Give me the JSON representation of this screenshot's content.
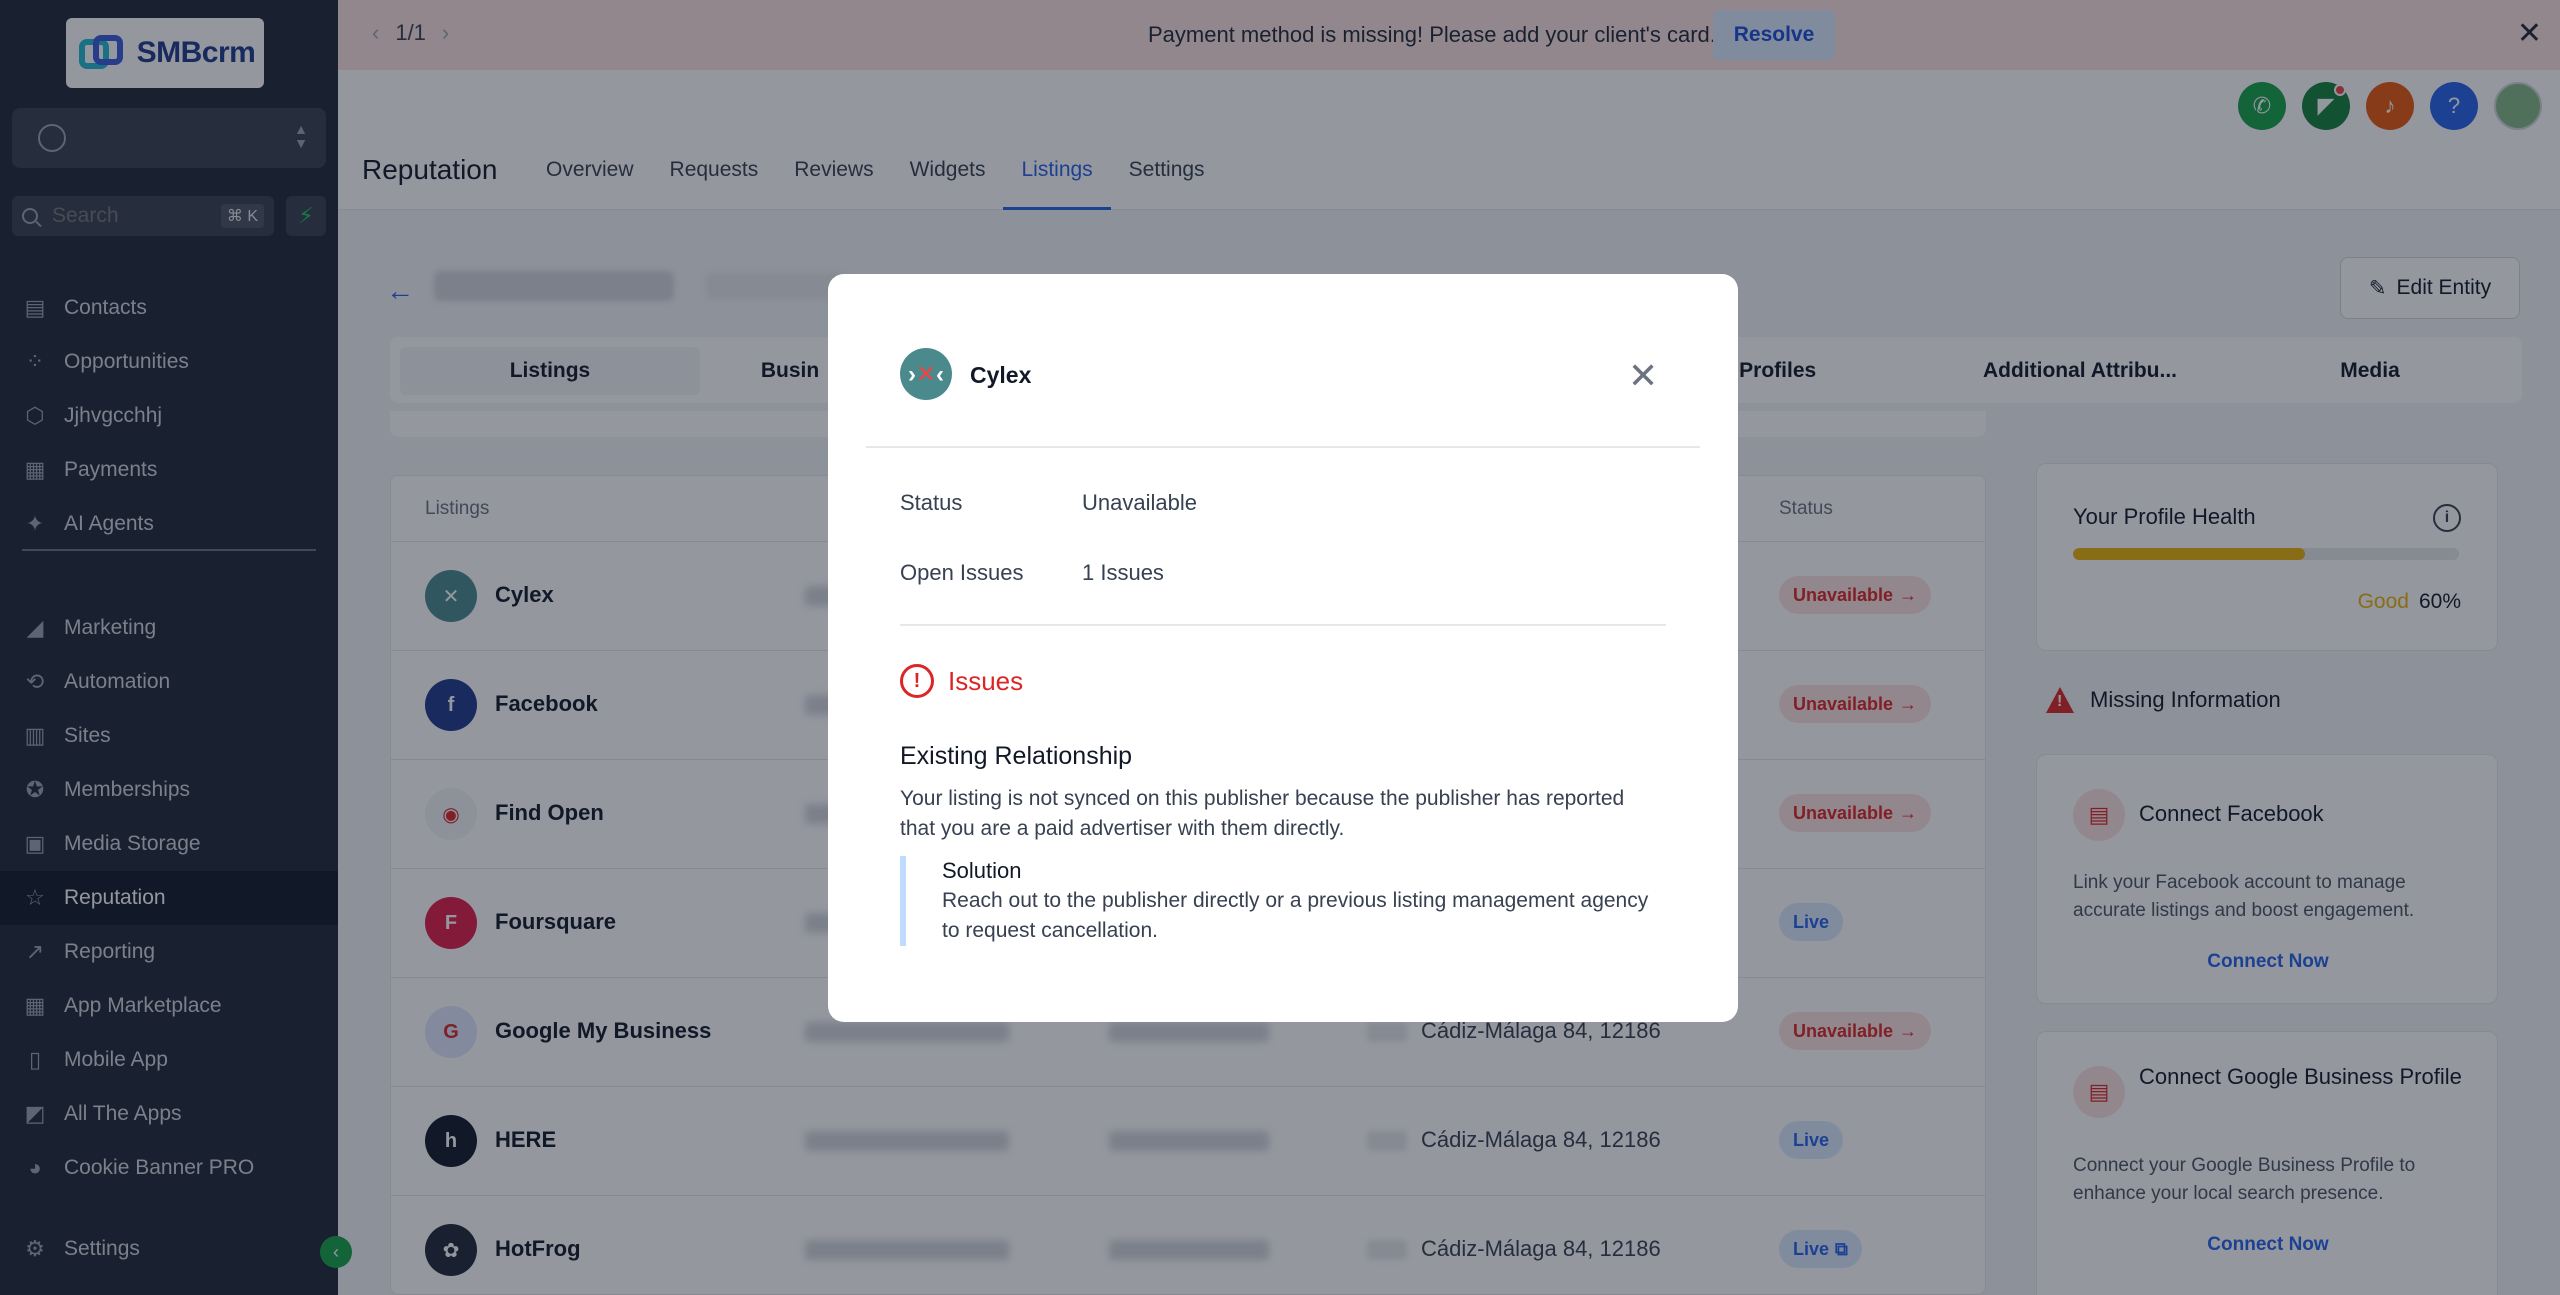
{
  "banner": {
    "pager": "1/1",
    "message": "Payment method is missing! Please add your client's card.",
    "resolve_label": "Resolve"
  },
  "brand": {
    "name": "SMBcrm"
  },
  "search": {
    "placeholder": "Search",
    "shortcut": "⌘ K"
  },
  "sidebar": {
    "items_top": [
      {
        "label": "Contacts",
        "icon": "contacts-icon"
      },
      {
        "label": "Opportunities",
        "icon": "opportunities-icon"
      },
      {
        "label": "Jjhvgcchhj",
        "icon": "cube-icon"
      },
      {
        "label": "Payments",
        "icon": "payments-icon"
      },
      {
        "label": "AI Agents",
        "icon": "sparkle-icon"
      }
    ],
    "items_bottom": [
      {
        "label": "Marketing",
        "icon": "megaphone-icon"
      },
      {
        "label": "Automation",
        "icon": "automation-icon"
      },
      {
        "label": "Sites",
        "icon": "sites-icon"
      },
      {
        "label": "Memberships",
        "icon": "memberships-icon"
      },
      {
        "label": "Media Storage",
        "icon": "image-icon"
      },
      {
        "label": "Reputation",
        "icon": "star-icon",
        "active": true
      },
      {
        "label": "Reporting",
        "icon": "chart-icon"
      },
      {
        "label": "App Marketplace",
        "icon": "grid-icon"
      },
      {
        "label": "Mobile App",
        "icon": "mobile-icon"
      },
      {
        "label": "All The Apps",
        "icon": "apps-icon"
      },
      {
        "label": "Cookie Banner PRO",
        "icon": "cookie-icon"
      }
    ],
    "settings_label": "Settings"
  },
  "header": {
    "title": "Reputation",
    "tabs": [
      "Overview",
      "Requests",
      "Reviews",
      "Widgets",
      "Listings",
      "Settings"
    ],
    "active_tab": "Listings"
  },
  "entity": {
    "edit_label": "Edit Entity"
  },
  "subtabs": [
    "Listings",
    "Busin",
    "al Profiles",
    "Additional Attribu...",
    "Media"
  ],
  "table": {
    "col_listings": "Listings",
    "col_status": "Status",
    "rows": [
      {
        "name": "Cylex",
        "address": "",
        "status": "Unavailable",
        "kind": "unavail",
        "color": "#4a8a8c",
        "glyph": "✕"
      },
      {
        "name": "Facebook",
        "address": "",
        "status": "Unavailable",
        "kind": "unavail",
        "color": "#1e3a8a",
        "glyph": "f"
      },
      {
        "name": "Find Open",
        "address": "",
        "status": "Unavailable",
        "kind": "unavail",
        "color": "#f3f4f6",
        "glyph": "◉"
      },
      {
        "name": "Foursquare",
        "address": "",
        "status": "Live",
        "kind": "live",
        "color": "#e11d48",
        "glyph": "F"
      },
      {
        "name": "Google My Business",
        "address": "Cádiz-Málaga 84, 12186",
        "status": "Unavailable",
        "kind": "unavail",
        "color": "#e0e7ff",
        "glyph": "G"
      },
      {
        "name": "HERE",
        "address": "Cádiz-Málaga 84, 12186",
        "status": "Live",
        "kind": "live",
        "color": "#111827",
        "glyph": "h"
      },
      {
        "name": "HotFrog",
        "address": "Cádiz-Málaga 84, 12186",
        "status": "Live",
        "kind": "live",
        "color": "#1f2937",
        "glyph": "✿"
      }
    ]
  },
  "health": {
    "title": "Your Profile Health",
    "rating": "Good",
    "percent_text": "60%",
    "percent": 0.6
  },
  "missing": {
    "title": "Missing Information",
    "cards": [
      {
        "title": "Connect Facebook",
        "desc": "Link your Facebook account to manage accurate listings and boost engagement.",
        "link": "Connect Now"
      },
      {
        "title": "Connect Google Business Profile",
        "desc": "Connect your Google Business Profile to enhance your local search presence.",
        "link": "Connect Now"
      }
    ]
  },
  "modal": {
    "publisher": "Cylex",
    "status_key": "Status",
    "status_value": "Unavailable",
    "issues_key": "Open Issues",
    "issues_value": "1 Issues",
    "issues_heading": "Issues",
    "issue_title": "Existing Relationship",
    "issue_desc": "Your listing is not synced on this publisher because the publisher has reported that you are a paid advertiser with them directly.",
    "solution_title": "Solution",
    "solution_desc": "Reach out to the publisher directly or a previous listing management agency to request cancellation."
  },
  "colors": {
    "accent": "#2563eb",
    "danger": "#dc2626",
    "warning": "#eab308",
    "sidebar_bg": "#1f2937"
  }
}
